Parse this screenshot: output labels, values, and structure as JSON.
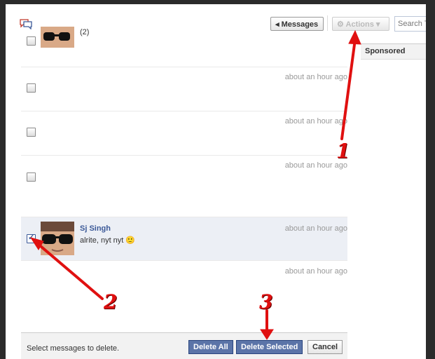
{
  "header": {
    "messages_label": "Messages",
    "actions_label": "Actions",
    "search_placeholder": "Search T"
  },
  "sidebar": {
    "sponsored_label": "Sponsored"
  },
  "messages": [
    {
      "time": "",
      "sender": "",
      "snippet": "(2)",
      "checked": false,
      "has_avatar": true
    },
    {
      "time": "about an hour ago",
      "sender": "",
      "snippet": "",
      "checked": false
    },
    {
      "time": "about an hour ago",
      "sender": "",
      "snippet": "",
      "checked": false
    },
    {
      "time": "about an hour ago",
      "sender": "",
      "snippet": "",
      "checked": false
    },
    {
      "time": "about an hour ago",
      "sender": "Sj Singh",
      "snippet": "alrite, nyt nyt 🙂",
      "checked": true,
      "has_avatar": true
    },
    {
      "time": "about an hour ago",
      "sender": "",
      "snippet": "",
      "checked": false
    }
  ],
  "footer": {
    "instruction": "Select messages to delete.",
    "delete_all_label": "Delete All",
    "delete_selected_label": "Delete Selected",
    "cancel_label": "Cancel"
  },
  "annotations": {
    "one": "1",
    "two": "2",
    "three": "3"
  },
  "colors": {
    "accent": "#3b5998",
    "annotation": "#e01010",
    "selected_row": "#eceff5"
  }
}
